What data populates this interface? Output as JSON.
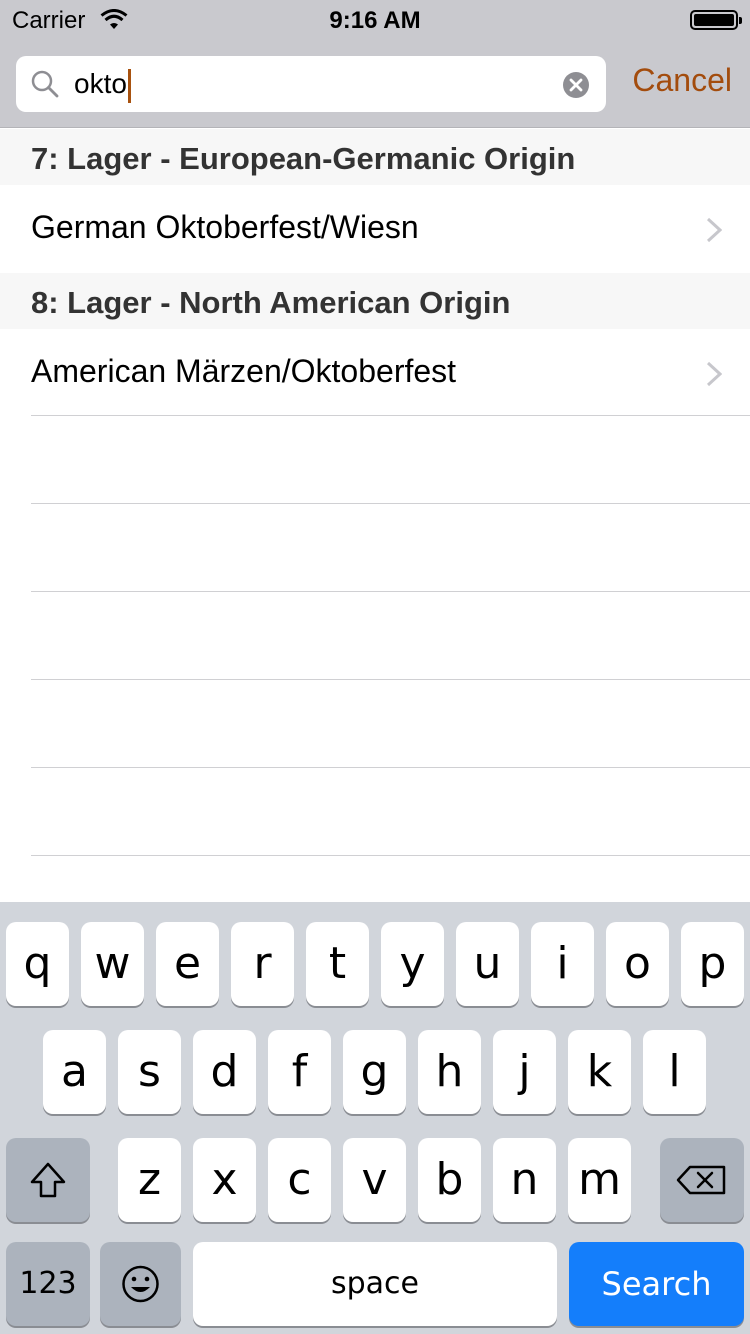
{
  "status_bar": {
    "carrier": "Carrier",
    "time": "9:16 AM"
  },
  "search": {
    "value": "okto",
    "cancel_label": "Cancel"
  },
  "results": [
    {
      "section": "7: Lager - European-Germanic Origin",
      "items": [
        "German Oktoberfest/Wiesn"
      ]
    },
    {
      "section": "8: Lager - North American Origin",
      "items": [
        "American Märzen/Oktoberfest"
      ]
    }
  ],
  "keyboard": {
    "row1": [
      "q",
      "w",
      "e",
      "r",
      "t",
      "y",
      "u",
      "i",
      "o",
      "p"
    ],
    "row2": [
      "a",
      "s",
      "d",
      "f",
      "g",
      "h",
      "j",
      "k",
      "l"
    ],
    "row3": [
      "z",
      "x",
      "c",
      "v",
      "b",
      "n",
      "m"
    ],
    "numbers_label": "123",
    "space_label": "space",
    "search_label": "Search"
  },
  "colors": {
    "accent": "#a34c0d",
    "search_key": "#147efb",
    "header_bg": "#c9c9ce"
  }
}
